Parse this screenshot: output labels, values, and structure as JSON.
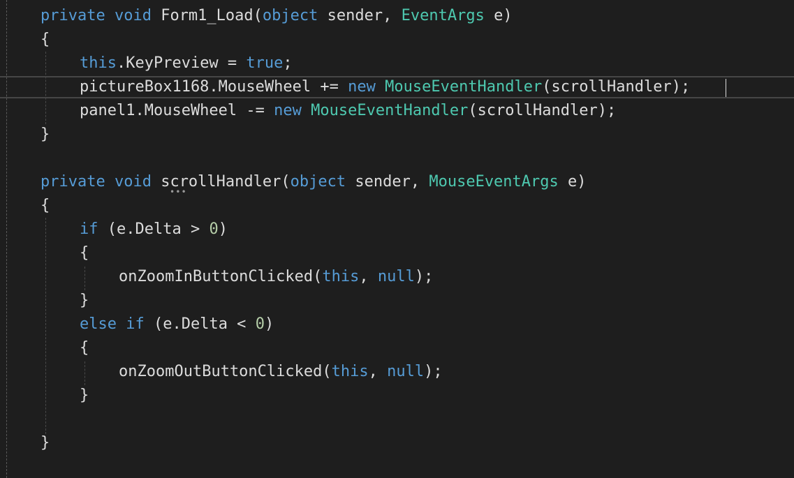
{
  "editor": {
    "lines": [
      [
        [
          "kw",
          "private"
        ],
        [
          "id",
          " "
        ],
        [
          "kw",
          "void"
        ],
        [
          "id",
          " Form1_Load("
        ],
        [
          "kw",
          "object"
        ],
        [
          "id",
          " sender, "
        ],
        [
          "type",
          "EventArgs"
        ],
        [
          "id",
          " e)"
        ]
      ],
      [
        [
          "id",
          "{"
        ]
      ],
      [
        [
          "kw",
          "this"
        ],
        [
          "id",
          ".KeyPreview = "
        ],
        [
          "kw",
          "true"
        ],
        [
          "id",
          ";"
        ]
      ],
      [
        [
          "id",
          "pictureBox1168.MouseWheel += "
        ],
        [
          "kw",
          "new"
        ],
        [
          "id",
          " "
        ],
        [
          "type",
          "MouseEventHandler"
        ],
        [
          "id",
          "(scrollHandler);"
        ]
      ],
      [
        [
          "id",
          "panel1.MouseWheel -= "
        ],
        [
          "kw",
          "new"
        ],
        [
          "id",
          " "
        ],
        [
          "type",
          "MouseEventHandler"
        ],
        [
          "id",
          "(scrollHandler);"
        ]
      ],
      [
        [
          "id",
          "}"
        ]
      ],
      [],
      [
        [
          "kw",
          "private"
        ],
        [
          "id",
          " "
        ],
        [
          "kw",
          "void"
        ],
        [
          "id",
          " scrollHandler("
        ],
        [
          "kw",
          "object"
        ],
        [
          "id",
          " sender, "
        ],
        [
          "type",
          "MouseEventArgs"
        ],
        [
          "id",
          " e)"
        ]
      ],
      [
        [
          "id",
          "{"
        ]
      ],
      [
        [
          "kw",
          "if"
        ],
        [
          "id",
          " (e.Delta > "
        ],
        [
          "num",
          "0"
        ],
        [
          "id",
          ")"
        ]
      ],
      [
        [
          "id",
          "{"
        ]
      ],
      [
        [
          "id",
          "onZoomInButtonClicked("
        ],
        [
          "kw",
          "this"
        ],
        [
          "id",
          ", "
        ],
        [
          "kw",
          "null"
        ],
        [
          "id",
          ");"
        ]
      ],
      [
        [
          "id",
          "}"
        ]
      ],
      [
        [
          "kw",
          "else"
        ],
        [
          "id",
          " "
        ],
        [
          "kw",
          "if"
        ],
        [
          "id",
          " (e.Delta < "
        ],
        [
          "num",
          "0"
        ],
        [
          "id",
          ")"
        ]
      ],
      [
        [
          "id",
          "{"
        ]
      ],
      [
        [
          "id",
          "onZoomOutButtonClicked("
        ],
        [
          "kw",
          "this"
        ],
        [
          "id",
          ", "
        ],
        [
          "kw",
          "null"
        ],
        [
          "id",
          ");"
        ]
      ],
      [
        [
          "id",
          "}"
        ]
      ],
      [],
      [
        [
          "id",
          "}"
        ]
      ]
    ],
    "quick_action_hint": "•••"
  },
  "colors": {
    "background": "#1e1e1e",
    "keyword": "#569cd6",
    "type": "#4ec9b0",
    "number": "#b5cea8",
    "identifier": "#dcdcdc"
  }
}
